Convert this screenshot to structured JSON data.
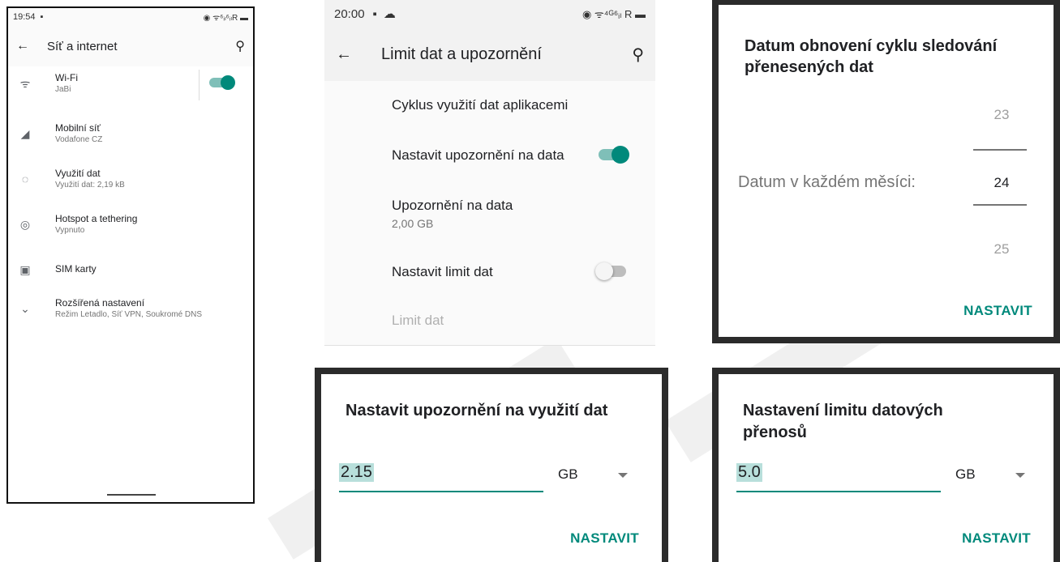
{
  "panel_network": {
    "status_time": "19:54",
    "status_right": "◉ ᯤ⁶ᵢₗ⁶ᵢₗR ▬",
    "title": "Síť a internet",
    "items": [
      {
        "title": "Wi-Fi",
        "subtitle": "JaBi",
        "icon": "wifi-icon"
      },
      {
        "title": "Mobilní síť",
        "subtitle": "Vodafone CZ",
        "icon": "signal-icon"
      },
      {
        "title": "Využití dat",
        "subtitle": "Využití dat: 2,19 kB",
        "icon": "data-usage-icon"
      },
      {
        "title": "Hotspot a tethering",
        "subtitle": "Vypnuto",
        "icon": "hotspot-icon"
      },
      {
        "title": "SIM karty",
        "subtitle": "",
        "icon": "sim-icon"
      },
      {
        "title": "Rozšířená nastavení",
        "subtitle": "Režim Letadlo, Síť VPN, Soukromé DNS",
        "icon": "chevron-down-icon"
      }
    ]
  },
  "panel_limit": {
    "status_time": "20:00",
    "status_right": "◉ ᯤ⁴ᴳ⁶ᵢₗ R ▬",
    "title": "Limit dat a upozornění",
    "cycle": "Cyklus využití dat aplikacemi",
    "warning_toggle": "Nastavit upozornění na data",
    "warning": "Upozornění na data",
    "warning_value": "2,00 GB",
    "limit_toggle": "Nastavit limit dat",
    "limit": "Limit dat"
  },
  "panel_cycle": {
    "title": "Datum obnovení cyklu sledování přenesených dat",
    "label": "Datum v každém měsíci:",
    "prev": "23",
    "current": "24",
    "next": "25",
    "button": "NASTAVIT"
  },
  "panel_warning": {
    "title": "Nastavit upozornění na využití dat",
    "value": "2.15",
    "unit": "GB",
    "button": "NASTAVIT"
  },
  "panel_limit_dialog": {
    "title": "Nastavení limitu datových přenosů",
    "value": "5.0",
    "unit": "GB",
    "button": "NASTAVIT"
  }
}
